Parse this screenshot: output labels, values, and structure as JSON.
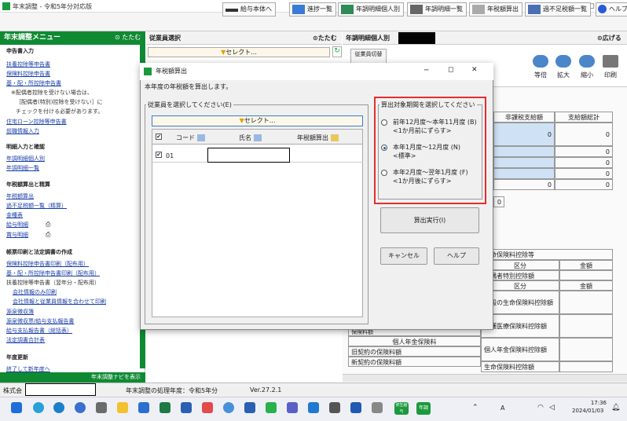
{
  "window": {
    "title": "年末調整 - 令和5年分対応版"
  },
  "toolbar": {
    "salary_main": "給与本体へ",
    "progress_list": "進捗一覧",
    "year_detail_individual": "年調明細個人別",
    "year_detail_list": "年調明細一覧",
    "tax_calc": "年税額算出",
    "over_under_list": "過不足税額一覧",
    "help": "ヘルプ"
  },
  "menu": {
    "title": "年末調整メニュー",
    "collapse": "たたむ",
    "sections": {
      "declaration": "申告書入力",
      "detail": "明細入力と確認",
      "calc": "年税額算出と精算",
      "print": "帳票印刷と法定調書の作成",
      "update": "年度更新"
    },
    "items": {
      "fuyo": "扶養控除等申告書",
      "hoken": "保険料控除申告書",
      "kiso": "基・配・所控除申告書",
      "note1": "※配偶者控除を受けない場合は、",
      "note2": "［配偶者(特別)控除を受けない］に",
      "note3": "チェックを付ける必要があります。",
      "jutaku": "住宅ローン控除等申告書",
      "zenshoku": "前職情報入力",
      "meisai_kojin": "年調明細個人別",
      "meisai_ichiran": "年調明細一覧",
      "nenzei": "年税額算出",
      "kafusoku": "過不足税額一覧（精算）",
      "kinshu": "金種表",
      "kyuyo_meisai": "給与明細",
      "shoyo_meisai": "賞与明細",
      "p_hoken": "保険料控除申告書印刷（配布用）",
      "p_kiso": "基・配・所控除申告書印刷（配布用）",
      "p_fuyo": "扶養控除等申告書（翌年分・配布用）",
      "kaisha_only": "会社情報のみ印刷",
      "kaisha_jugyoin": "会社情報と従業員情報を合わせて印刷",
      "gensen": "源泉徴収簿",
      "gensen_hyo": "源泉徴収票/給与支払報告書",
      "shiharai": "給与支払報告書（総括表）",
      "houtei": "法定調書合計表",
      "shuryo": "終了して新年度へ"
    },
    "navbar_toggle": "年末調整ナビを表示"
  },
  "employee_select": {
    "title": "従業員選択",
    "collapse": "たたむ",
    "select_btn": "セレクト...",
    "switch_btn": "従業員切替"
  },
  "detail_panel": {
    "title": "年調明細個人別",
    "expand": "広げる",
    "tools": {
      "fit": "等倍",
      "zoom_in": "拡大",
      "zoom_out": "縮小",
      "print": "印刷"
    },
    "headers": [
      "非課税支給額",
      "支給額総計"
    ],
    "zeros": [
      "0",
      "0",
      "0",
      "0",
      "0",
      "0",
      "0",
      "0"
    ],
    "insurance": {
      "title": "生命保険料控除等",
      "kubun": "区分",
      "kingaku": "金額",
      "haigusha": "配偶者特別控除額",
      "ippan": "一般の生命保険料控除額",
      "kaigo": "介護医療保険料控除額",
      "hokenryo": "保険料額",
      "kojin_nenkin": "個人年金保険料",
      "kyu": "旧契約の保険料額",
      "shin": "新契約の保険料額",
      "kojin_nenkin_kojo": "個人年金保険料控除額",
      "seimei_kojo": "生命保険料控除額"
    }
  },
  "dialog": {
    "title": "年税額算出",
    "description": "本年度の年税額を算出します。",
    "employee_group": "従業員を選択してください(E)",
    "select_btn": "セレクト...",
    "table": {
      "col_code": "コード",
      "col_name": "氏名",
      "col_tax": "年税額算出",
      "rows": [
        {
          "code": "01"
        }
      ]
    },
    "period_group": "算出対象期間を選択してください",
    "options": [
      {
        "label": "前年12月度～本年11月度 (B)",
        "sub": "<1か月前にずらす>"
      },
      {
        "label": "本年1月度～12月度 (N)",
        "sub": "<標準>"
      },
      {
        "label": "本年2月度～翌年1月度 (F)",
        "sub": "<1か月後にずらす>"
      }
    ],
    "execute": "算出実行(I)",
    "cancel": "キャンセル",
    "help": "ヘルプ"
  },
  "statusbar": {
    "company": "株式会",
    "fiscal": "年末調整の処理年度：令和5年分",
    "version": "Ver.27.2.1"
  },
  "taskbar": {
    "time": "17:36",
    "date": "2024/01/03",
    "ime": "A",
    "yayoi1": "弥生給与",
    "yayoi2": "年調"
  }
}
